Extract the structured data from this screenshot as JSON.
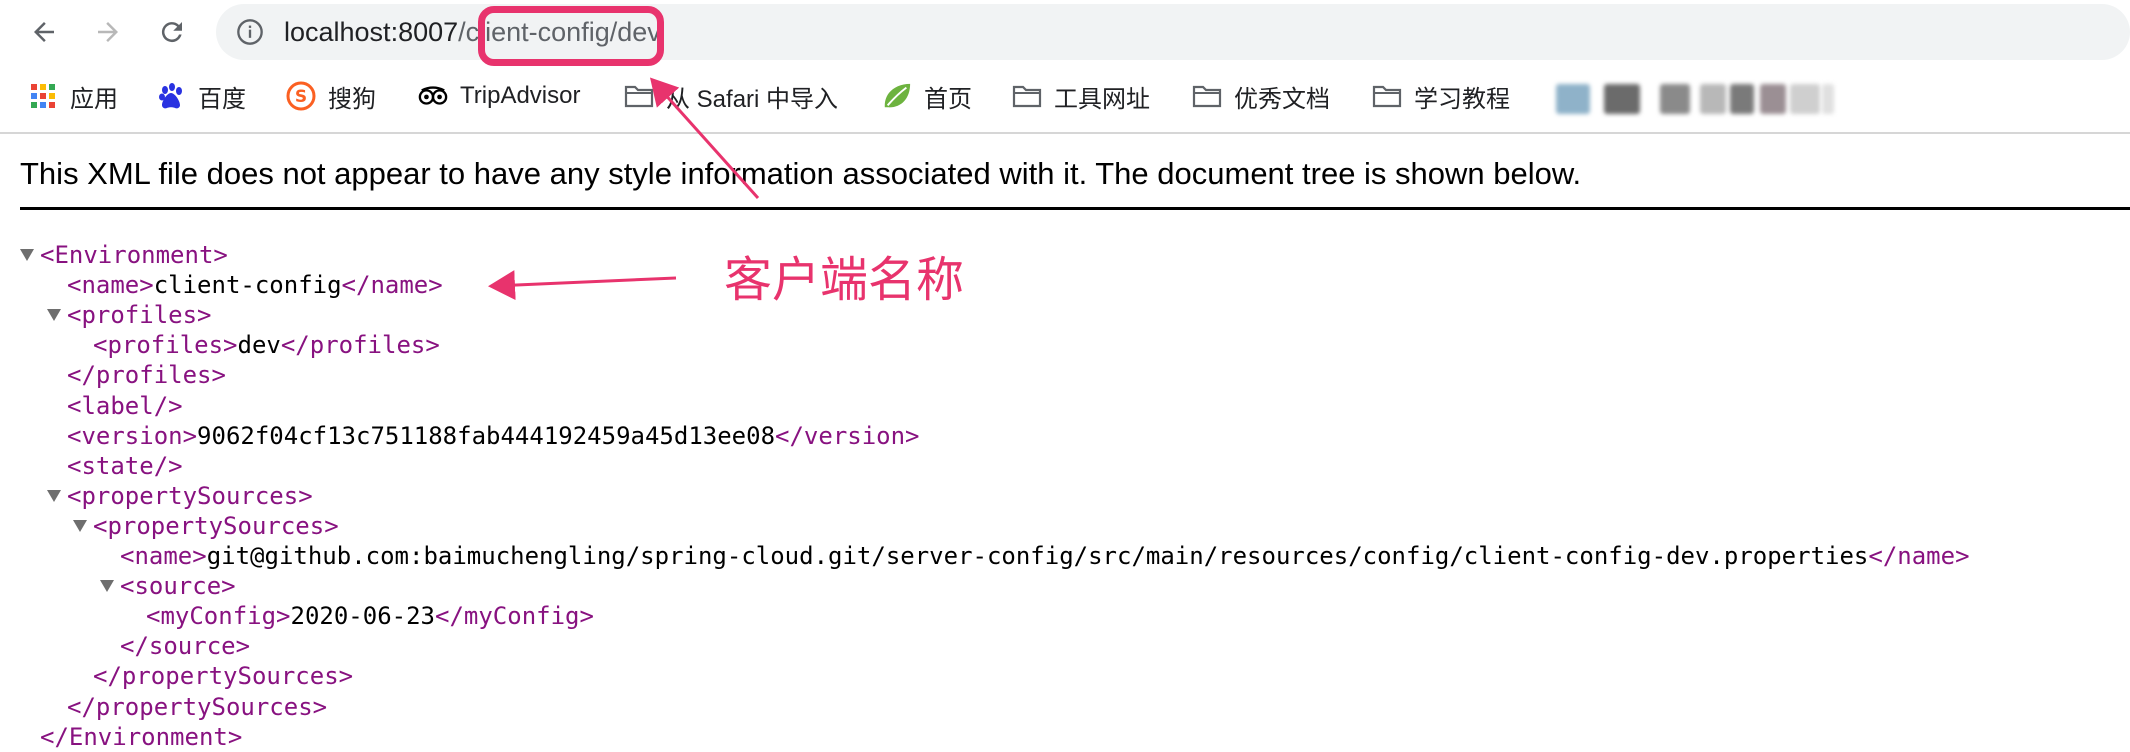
{
  "browser": {
    "url_host": "localhost:8007",
    "url_path": "/client-config/dev"
  },
  "bookmarks": [
    {
      "label": "应用",
      "icon": "apps-grid-icon"
    },
    {
      "label": "百度",
      "icon": "baidu-paw-icon"
    },
    {
      "label": "搜狗",
      "icon": "sogou-icon"
    },
    {
      "label": "TripAdvisor",
      "icon": "tripadvisor-owl-icon"
    },
    {
      "label": "从 Safari 中导入",
      "icon": "folder-icon"
    },
    {
      "label": "首页",
      "icon": "spring-leaf-icon"
    },
    {
      "label": "工具网址",
      "icon": "folder-icon"
    },
    {
      "label": "优秀文档",
      "icon": "folder-icon"
    },
    {
      "label": "学习教程",
      "icon": "folder-icon"
    }
  ],
  "xml_viewer": {
    "notice": "This XML file does not appear to have any style information associated with it. The document tree is shown below.",
    "lines": [
      {
        "open": "<Environment>",
        "text": "",
        "close": ""
      },
      {
        "open": "<name>",
        "text": "client-config",
        "close": "</name>"
      },
      {
        "open": "<profiles>",
        "text": "",
        "close": ""
      },
      {
        "open": "<profiles>",
        "text": "dev",
        "close": "</profiles>"
      },
      {
        "open": "</profiles>",
        "text": "",
        "close": ""
      },
      {
        "open": "<label/>",
        "text": "",
        "close": ""
      },
      {
        "open": "<version>",
        "text": "9062f04cf13c751188fab444192459a45d13ee08",
        "close": "</version>"
      },
      {
        "open": "<state/>",
        "text": "",
        "close": ""
      },
      {
        "open": "<propertySources>",
        "text": "",
        "close": ""
      },
      {
        "open": "<propertySources>",
        "text": "",
        "close": ""
      },
      {
        "open": "<name>",
        "text": "git@github.com:baimuchengling/spring-cloud.git/server-config/src/main/resources/config/client-config-dev.properties",
        "close": "</name>"
      },
      {
        "open": "<source>",
        "text": "",
        "close": ""
      },
      {
        "open": "<myConfig>",
        "text": "2020-06-23",
        "close": "</myConfig>"
      },
      {
        "open": "</source>",
        "text": "",
        "close": ""
      },
      {
        "open": "</propertySources>",
        "text": "",
        "close": ""
      },
      {
        "open": "</propertySources>",
        "text": "",
        "close": ""
      },
      {
        "open": "</Environment>",
        "text": "",
        "close": ""
      }
    ]
  },
  "annotation": {
    "label": "客户端名称",
    "color": "#e8336d"
  }
}
